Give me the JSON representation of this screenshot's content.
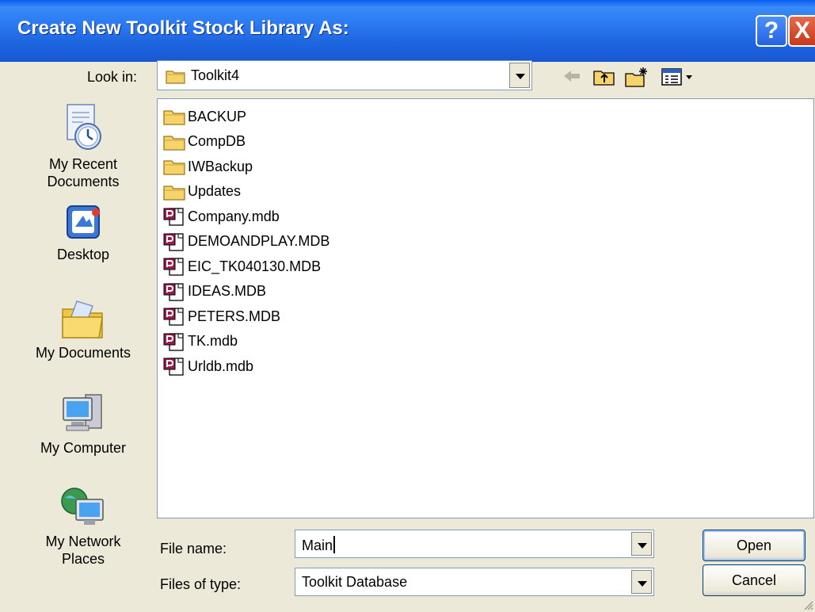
{
  "window": {
    "title": "Create New Toolkit Stock Library As:",
    "help_button": "?",
    "close_button": "X"
  },
  "lookin": {
    "label": "Look in:",
    "value": "Toolkit4"
  },
  "toolbar": {
    "icons": [
      "back-arrow-icon",
      "up-folder-icon",
      "new-folder-icon",
      "view-menu-icon"
    ]
  },
  "places": [
    {
      "label": "My Recent Documents",
      "icon": "recent-documents-icon"
    },
    {
      "label": "Desktop",
      "icon": "desktop-icon"
    },
    {
      "label": "My Documents",
      "icon": "my-documents-icon"
    },
    {
      "label": "My Computer",
      "icon": "my-computer-icon"
    },
    {
      "label": "My Network Places",
      "icon": "network-places-icon"
    }
  ],
  "files": [
    {
      "name": "BACKUP",
      "type": "folder"
    },
    {
      "name": "CompDB",
      "type": "folder"
    },
    {
      "name": "IWBackup",
      "type": "folder"
    },
    {
      "name": "Updates",
      "type": "folder"
    },
    {
      "name": "Company.mdb",
      "type": "mdb"
    },
    {
      "name": "DEMOANDPLAY.MDB",
      "type": "mdb"
    },
    {
      "name": "EIC_TK040130.MDB",
      "type": "mdb"
    },
    {
      "name": "IDEAS.MDB",
      "type": "mdb"
    },
    {
      "name": "PETERS.MDB",
      "type": "mdb"
    },
    {
      "name": "TK.mdb",
      "type": "mdb"
    },
    {
      "name": "Urldb.mdb",
      "type": "mdb"
    }
  ],
  "filename": {
    "label": "File name:",
    "value": "Main"
  },
  "filetype": {
    "label": "Files of type:",
    "value": "Toolkit Database"
  },
  "buttons": {
    "open": "Open",
    "cancel": "Cancel"
  },
  "colors": {
    "titlebar": "#1e65e0",
    "dialog_bg": "#ece9d8",
    "folder": "#f6d36b",
    "mdb": "#9b1b4f"
  }
}
